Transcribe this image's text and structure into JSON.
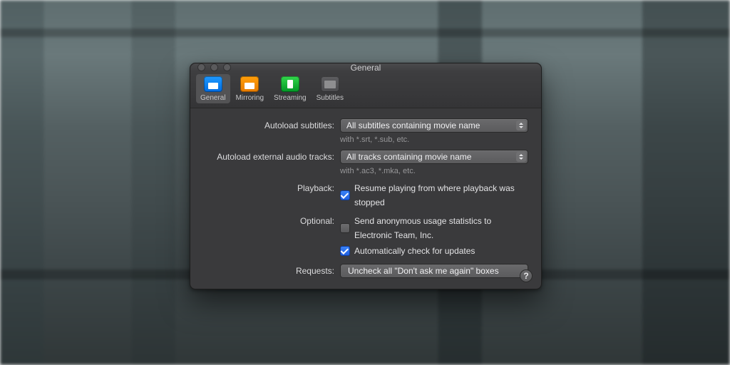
{
  "window": {
    "title": "General"
  },
  "toolbar": {
    "tabs": [
      {
        "id": "general",
        "label": "General",
        "active": true
      },
      {
        "id": "mirroring",
        "label": "Mirroring",
        "active": false
      },
      {
        "id": "streaming",
        "label": "Streaming",
        "active": false
      },
      {
        "id": "subtitles",
        "label": "Subtitles",
        "active": false
      }
    ]
  },
  "form": {
    "autoload_subtitles": {
      "label": "Autoload subtitles:",
      "value": "All subtitles containing movie name",
      "hint": "with *.srt, *.sub, etc."
    },
    "autoload_audio": {
      "label": "Autoload external audio tracks:",
      "value": "All tracks containing movie name",
      "hint": "with *.ac3, *.mka, etc."
    },
    "playback": {
      "label": "Playback:",
      "resume": {
        "checked": true,
        "text": "Resume playing from where playback was stopped"
      }
    },
    "optional": {
      "label": "Optional:",
      "stats": {
        "checked": false,
        "text": "Send anonymous usage statistics to Electronic Team, Inc."
      },
      "updates": {
        "checked": true,
        "text": "Automatically check for updates"
      }
    },
    "requests": {
      "label": "Requests:",
      "button": "Uncheck all \"Don't ask me again\" boxes"
    }
  },
  "help": "?"
}
